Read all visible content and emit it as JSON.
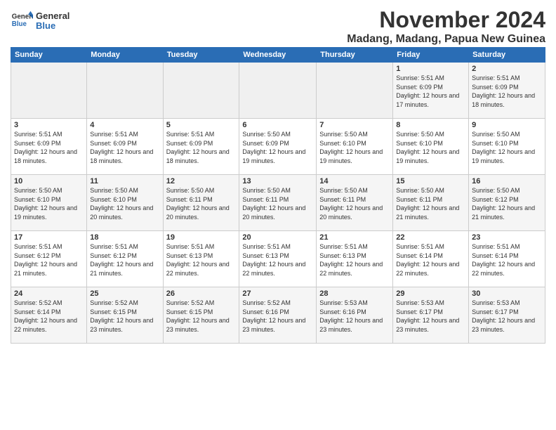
{
  "logo": {
    "general": "General",
    "blue": "Blue"
  },
  "title": "November 2024",
  "location": "Madang, Madang, Papua New Guinea",
  "headers": [
    "Sunday",
    "Monday",
    "Tuesday",
    "Wednesday",
    "Thursday",
    "Friday",
    "Saturday"
  ],
  "weeks": [
    [
      {
        "day": "",
        "info": ""
      },
      {
        "day": "",
        "info": ""
      },
      {
        "day": "",
        "info": ""
      },
      {
        "day": "",
        "info": ""
      },
      {
        "day": "",
        "info": ""
      },
      {
        "day": "1",
        "info": "Sunrise: 5:51 AM\nSunset: 6:09 PM\nDaylight: 12 hours\nand 17 minutes."
      },
      {
        "day": "2",
        "info": "Sunrise: 5:51 AM\nSunset: 6:09 PM\nDaylight: 12 hours\nand 18 minutes."
      }
    ],
    [
      {
        "day": "3",
        "info": "Sunrise: 5:51 AM\nSunset: 6:09 PM\nDaylight: 12 hours\nand 18 minutes."
      },
      {
        "day": "4",
        "info": "Sunrise: 5:51 AM\nSunset: 6:09 PM\nDaylight: 12 hours\nand 18 minutes."
      },
      {
        "day": "5",
        "info": "Sunrise: 5:51 AM\nSunset: 6:09 PM\nDaylight: 12 hours\nand 18 minutes."
      },
      {
        "day": "6",
        "info": "Sunrise: 5:50 AM\nSunset: 6:09 PM\nDaylight: 12 hours\nand 19 minutes."
      },
      {
        "day": "7",
        "info": "Sunrise: 5:50 AM\nSunset: 6:10 PM\nDaylight: 12 hours\nand 19 minutes."
      },
      {
        "day": "8",
        "info": "Sunrise: 5:50 AM\nSunset: 6:10 PM\nDaylight: 12 hours\nand 19 minutes."
      },
      {
        "day": "9",
        "info": "Sunrise: 5:50 AM\nSunset: 6:10 PM\nDaylight: 12 hours\nand 19 minutes."
      }
    ],
    [
      {
        "day": "10",
        "info": "Sunrise: 5:50 AM\nSunset: 6:10 PM\nDaylight: 12 hours\nand 19 minutes."
      },
      {
        "day": "11",
        "info": "Sunrise: 5:50 AM\nSunset: 6:10 PM\nDaylight: 12 hours\nand 20 minutes."
      },
      {
        "day": "12",
        "info": "Sunrise: 5:50 AM\nSunset: 6:11 PM\nDaylight: 12 hours\nand 20 minutes."
      },
      {
        "day": "13",
        "info": "Sunrise: 5:50 AM\nSunset: 6:11 PM\nDaylight: 12 hours\nand 20 minutes."
      },
      {
        "day": "14",
        "info": "Sunrise: 5:50 AM\nSunset: 6:11 PM\nDaylight: 12 hours\nand 20 minutes."
      },
      {
        "day": "15",
        "info": "Sunrise: 5:50 AM\nSunset: 6:11 PM\nDaylight: 12 hours\nand 21 minutes."
      },
      {
        "day": "16",
        "info": "Sunrise: 5:50 AM\nSunset: 6:12 PM\nDaylight: 12 hours\nand 21 minutes."
      }
    ],
    [
      {
        "day": "17",
        "info": "Sunrise: 5:51 AM\nSunset: 6:12 PM\nDaylight: 12 hours\nand 21 minutes."
      },
      {
        "day": "18",
        "info": "Sunrise: 5:51 AM\nSunset: 6:12 PM\nDaylight: 12 hours\nand 21 minutes."
      },
      {
        "day": "19",
        "info": "Sunrise: 5:51 AM\nSunset: 6:13 PM\nDaylight: 12 hours\nand 22 minutes."
      },
      {
        "day": "20",
        "info": "Sunrise: 5:51 AM\nSunset: 6:13 PM\nDaylight: 12 hours\nand 22 minutes."
      },
      {
        "day": "21",
        "info": "Sunrise: 5:51 AM\nSunset: 6:13 PM\nDaylight: 12 hours\nand 22 minutes."
      },
      {
        "day": "22",
        "info": "Sunrise: 5:51 AM\nSunset: 6:14 PM\nDaylight: 12 hours\nand 22 minutes."
      },
      {
        "day": "23",
        "info": "Sunrise: 5:51 AM\nSunset: 6:14 PM\nDaylight: 12 hours\nand 22 minutes."
      }
    ],
    [
      {
        "day": "24",
        "info": "Sunrise: 5:52 AM\nSunset: 6:14 PM\nDaylight: 12 hours\nand 22 minutes."
      },
      {
        "day": "25",
        "info": "Sunrise: 5:52 AM\nSunset: 6:15 PM\nDaylight: 12 hours\nand 23 minutes."
      },
      {
        "day": "26",
        "info": "Sunrise: 5:52 AM\nSunset: 6:15 PM\nDaylight: 12 hours\nand 23 minutes."
      },
      {
        "day": "27",
        "info": "Sunrise: 5:52 AM\nSunset: 6:16 PM\nDaylight: 12 hours\nand 23 minutes."
      },
      {
        "day": "28",
        "info": "Sunrise: 5:53 AM\nSunset: 6:16 PM\nDaylight: 12 hours\nand 23 minutes."
      },
      {
        "day": "29",
        "info": "Sunrise: 5:53 AM\nSunset: 6:17 PM\nDaylight: 12 hours\nand 23 minutes."
      },
      {
        "day": "30",
        "info": "Sunrise: 5:53 AM\nSunset: 6:17 PM\nDaylight: 12 hours\nand 23 minutes."
      }
    ]
  ]
}
